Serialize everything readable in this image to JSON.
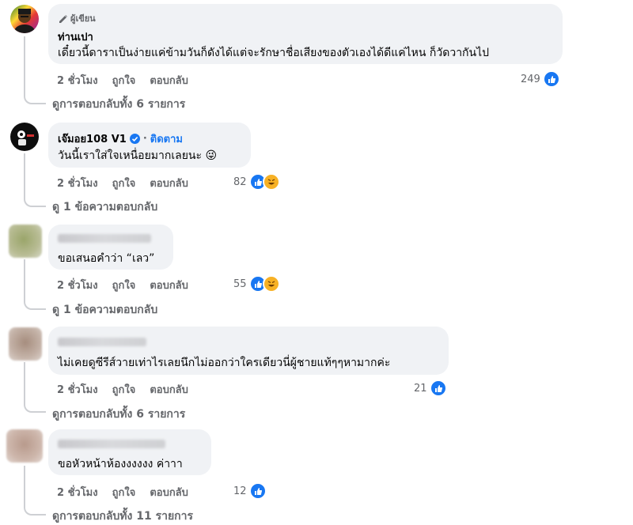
{
  "comments": [
    {
      "badge": "ผู้เขียน",
      "name": "ท่านเปา",
      "text": "เดี๋ยวนี้ดาราเป็นง่ายแค่ข้ามวันก็ดังได้แต่จะรักษาชื่อเสียงของตัวเองได้ดีแค่ไหน ก็วัดวากันไป",
      "time": "2 ชั่วโมง",
      "like": "ถูกใจ",
      "reply": "ตอบกลับ",
      "react_count": "249",
      "view_replies": "ดูการตอบกลับทั้ง 6 รายการ"
    },
    {
      "name": "เจ๊มอย108 V1",
      "follow": "ติดตาม",
      "text": "วันนี้เราใส่ใจเหนื่อยมากเลยนะ 😜",
      "time": "2 ชั่วโมง",
      "like": "ถูกใจ",
      "reply": "ตอบกลับ",
      "react_count": "82",
      "view_replies": "ดู 1 ข้อความตอบกลับ"
    },
    {
      "text": "ขอเสนอคำว่า “เลว”",
      "time": "2 ชั่วโมง",
      "like": "ถูกใจ",
      "reply": "ตอบกลับ",
      "react_count": "55",
      "view_replies": "ดู 1 ข้อความตอบกลับ"
    },
    {
      "text": "ไม่เคยดูซีรีส์วายเท่าไรเลยนึกไม่ออกว่าใครเดียวนี่ผู้ชายแท้ๆๆหามากค่ะ",
      "time": "2 ชั่วโมง",
      "like": "ถูกใจ",
      "reply": "ตอบกลับ",
      "react_count": "21",
      "view_replies": "ดูการตอบกลับทั้ง 6 รายการ"
    },
    {
      "text": "ขอหัวหน้าห้องงงงงง ค่าาา",
      "time": "2 ชั่วโมง",
      "like": "ถูกใจ",
      "reply": "ตอบกลับ",
      "react_count": "12",
      "view_replies": "ดูการตอบกลับทั้ง 11 รายการ"
    }
  ],
  "colors": {
    "like_blue": "#1877f2",
    "bubble": "#f0f2f5",
    "muted": "#65676b"
  }
}
